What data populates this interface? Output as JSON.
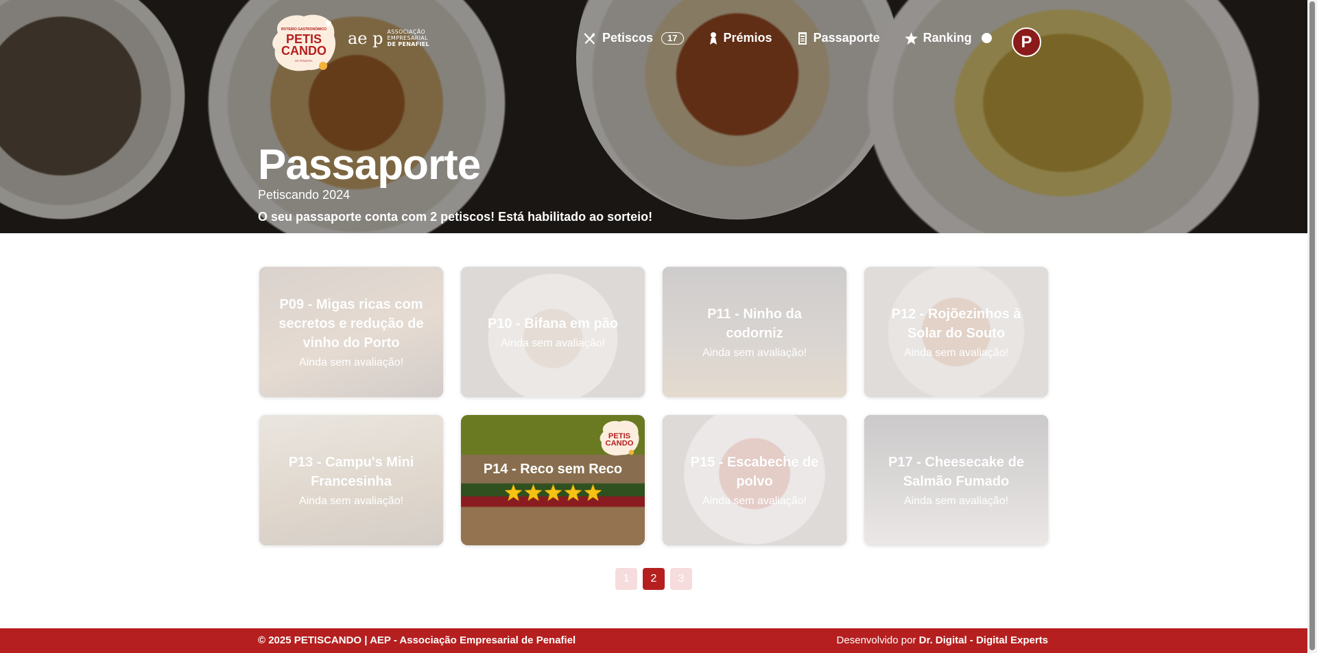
{
  "brand": {
    "logo_alt": "Petiscando",
    "aep_mark": "ae p",
    "aep_text": [
      "ASSOCIAÇÃO",
      "EMPRESARIAL",
      "DE PENAFIEL"
    ]
  },
  "nav": {
    "items": [
      {
        "label": "Petiscos",
        "icon": "cutlery-icon",
        "count": "17"
      },
      {
        "label": "Prémios",
        "icon": "award-icon"
      },
      {
        "label": "Passaporte",
        "icon": "passport-icon"
      },
      {
        "label": "Ranking",
        "icon": "star-icon"
      }
    ],
    "avatar_letter": "P"
  },
  "hero": {
    "title": "Passaporte",
    "subtitle": "Petiscando 2024",
    "note": "O seu passaporte conta com 2 petiscos! Está habilitado ao sorteio!"
  },
  "cards": [
    {
      "title": "P09 - Migas ricas com secretos e redução de vinho do Porto",
      "status": "Ainda sem avaliação!"
    },
    {
      "title": "P10 - Bifana em pão",
      "status": "Ainda sem avaliação!"
    },
    {
      "title": "P11 - Ninho da codorniz",
      "status": "Ainda sem avaliação!"
    },
    {
      "title": "P12 - Rojõezinhos à Solar do Souto",
      "status": "Ainda sem avaliação!"
    },
    {
      "title": "P13 - Campu's Mini Francesinha",
      "status": "Ainda sem avaliação!"
    },
    {
      "title": "P14 - Reco sem Reco",
      "rating": 5
    },
    {
      "title": "P15 - Escabeche de polvo",
      "status": "Ainda sem avaliação!"
    },
    {
      "title": "P17 - Cheesecake de Salmão Fumado",
      "status": "Ainda sem avaliação!"
    }
  ],
  "pagination": {
    "pages": [
      "1",
      "2",
      "3"
    ],
    "current": "2"
  },
  "footer": {
    "left": "© 2025 PETISCANDO | AEP - Associação Empresarial de Penafiel",
    "right_prefix": "Desenvolvido por",
    "right_strong": "Dr. Digital - Digital Experts"
  },
  "colors": {
    "brand_red": "#b51f1f",
    "avatar_red": "#8b1a1a",
    "star": "#f6c312"
  }
}
